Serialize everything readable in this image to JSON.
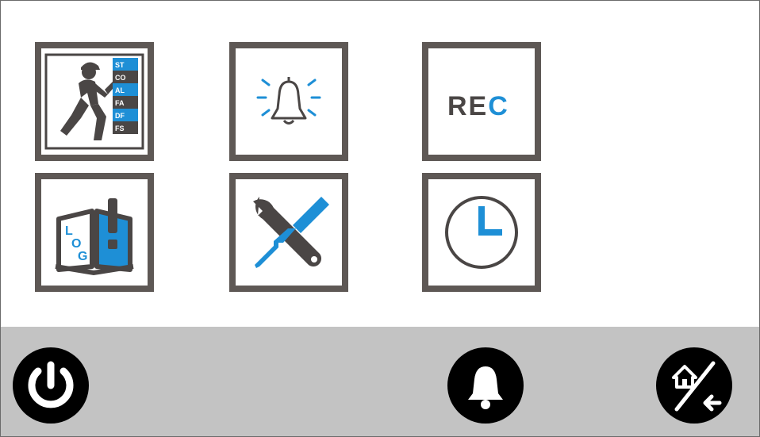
{
  "screen": {
    "tiles": [
      {
        "id": "status",
        "icon": "technician-status-icon",
        "badges": [
          "ST",
          "CO",
          "AL",
          "FA",
          "DF",
          "FS"
        ]
      },
      {
        "id": "alarm",
        "icon": "ringing-bell-icon"
      },
      {
        "id": "record",
        "icon": "rec-icon",
        "label_main": "RE",
        "label_accent": "C"
      },
      {
        "id": "log",
        "icon": "log-book-icon",
        "label": "LOG"
      },
      {
        "id": "settings",
        "icon": "tools-icon"
      },
      {
        "id": "clock",
        "icon": "clock-icon"
      }
    ]
  },
  "bottom_bar": {
    "buttons": [
      {
        "id": "power",
        "icon": "power-icon"
      },
      {
        "id": "bell",
        "icon": "bell-icon"
      },
      {
        "id": "home-exit",
        "icon": "home-slash-back-icon"
      }
    ]
  },
  "colors": {
    "frame_border": "#5e5855",
    "icon_dark": "#4a4645",
    "accent_blue": "#1e8fd6",
    "bar_gray": "#c3c3c3"
  }
}
